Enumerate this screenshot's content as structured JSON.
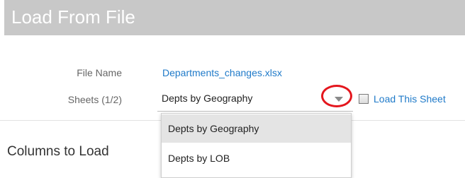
{
  "header": {
    "title": "Load From File"
  },
  "form": {
    "file_name_label": "File Name",
    "file_name_value": "Departments_changes.xlsx",
    "sheets_label": "Sheets (1/2)",
    "selected_sheet": "Depts by Geography",
    "load_sheet_label": "Load This Sheet",
    "load_sheet_checked": false
  },
  "dropdown": {
    "options": [
      "Depts by Geography",
      "Depts by LOB"
    ],
    "highlighted_index": 0
  },
  "section": {
    "columns_heading": "Columns to Load"
  },
  "annotation": {
    "highlight_color": "#e4161d"
  },
  "colors": {
    "title_bar": "#c8c8c8",
    "link": "#1f7ac9"
  }
}
